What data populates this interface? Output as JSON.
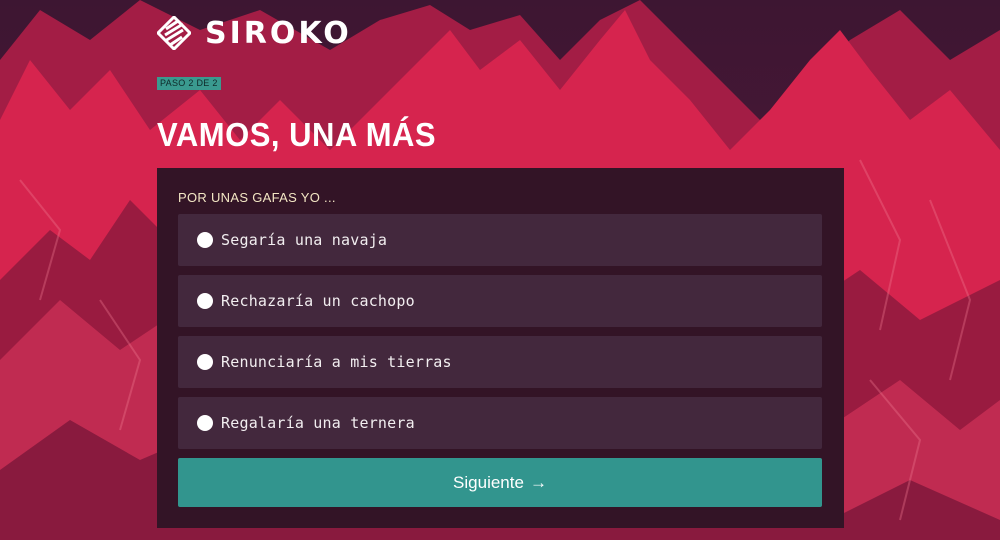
{
  "brand": {
    "name": "SIROKO"
  },
  "step": {
    "label": "PASO 2 DE 2"
  },
  "heading": {
    "title": "VAMOS, UNA MÁS"
  },
  "quiz": {
    "question": "POR UNAS GAFAS YO ...",
    "options": [
      {
        "label": "Segaría una navaja"
      },
      {
        "label": "Rechazaría un cachopo"
      },
      {
        "label": "Renunciaría a mis tierras"
      },
      {
        "label": "Regalaría una ternera"
      }
    ],
    "next_label": "Siguiente",
    "next_icon": "arrow-right-icon"
  },
  "colors": {
    "background_red": "#d6244e",
    "background_dark": "#3a1530",
    "card": "#331426",
    "option": "#43283d",
    "accent_teal": "#32958e",
    "question_text": "#f3e6c4"
  }
}
